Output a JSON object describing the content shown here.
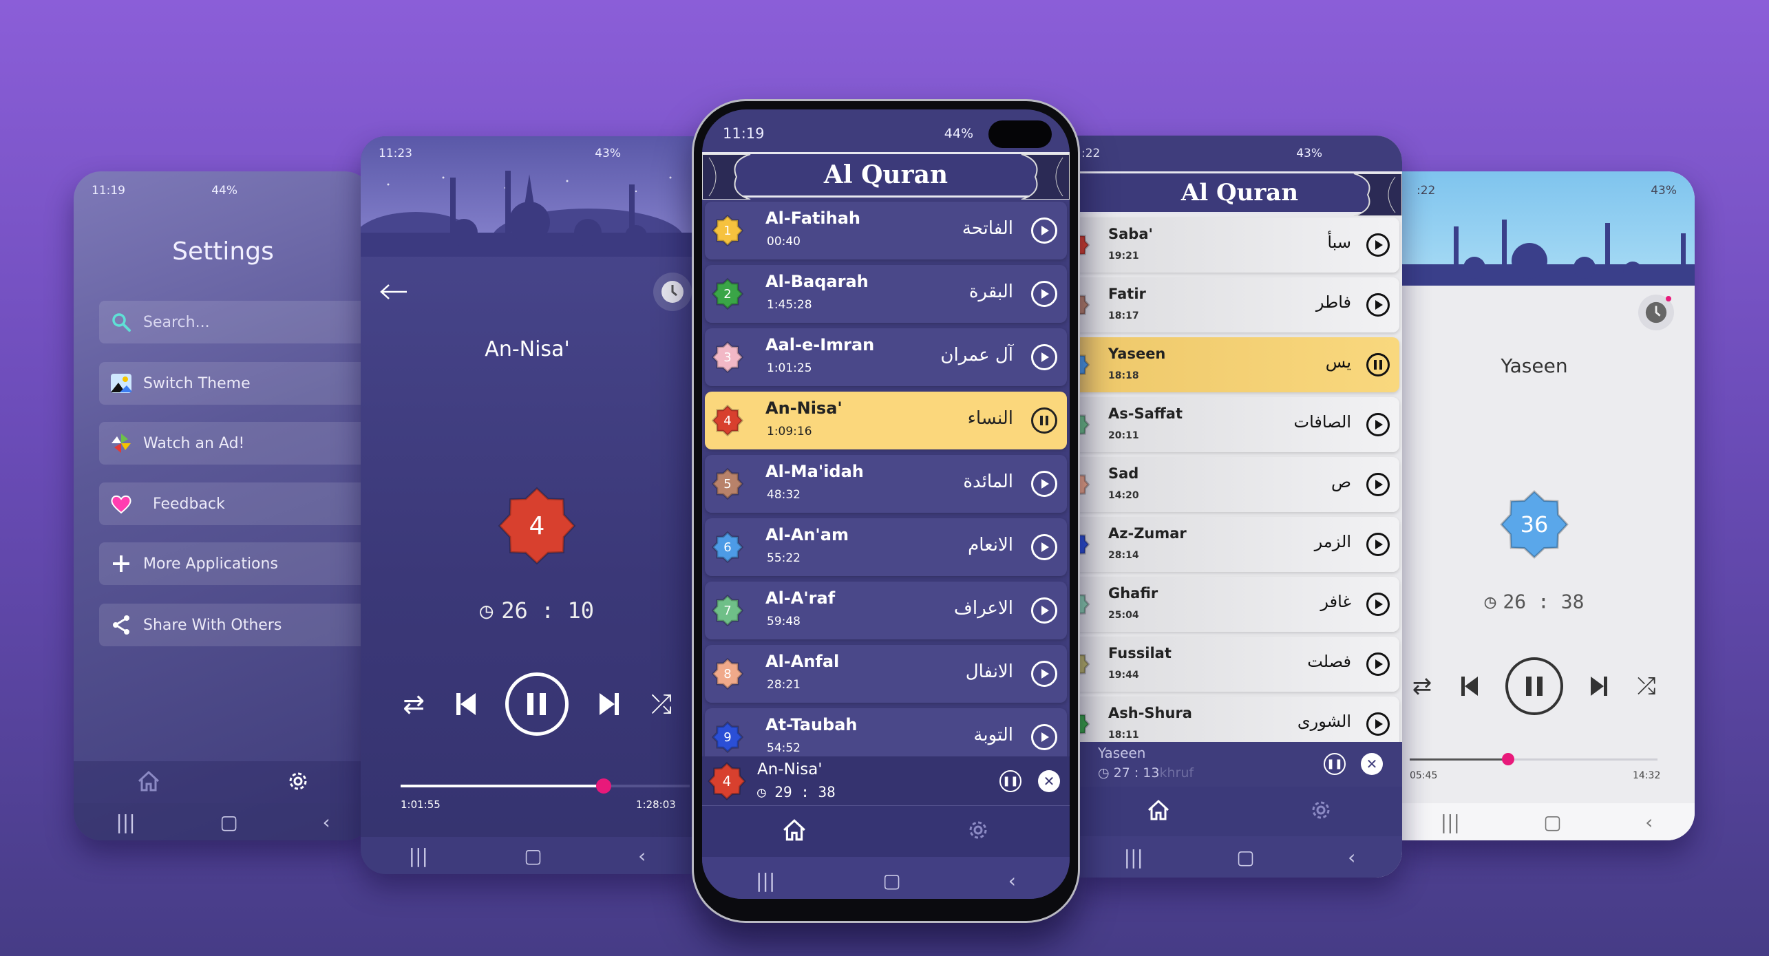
{
  "colors": {
    "accent": "#e8197a",
    "highlight": "#fbd77c",
    "primary": "#3f3d7c"
  },
  "settings_phone": {
    "status": {
      "time": "11:19",
      "battery": "44%"
    },
    "title": "Settings",
    "search_placeholder": "Search...",
    "items": [
      {
        "label": "Switch Theme",
        "icon": "image-icon"
      },
      {
        "label": "Watch an Ad!",
        "icon": "pinwheel-icon"
      },
      {
        "label": "Feedback",
        "icon": "heart-icon"
      },
      {
        "label": "More Applications",
        "icon": "plus-icon"
      },
      {
        "label": "Share With Others",
        "icon": "share-icon"
      }
    ]
  },
  "player_phone": {
    "status": {
      "time": "11:23",
      "battery": "43%"
    },
    "title": "An-Nisa'",
    "surah_number": "4",
    "timer": "26 : 10",
    "elapsed": "1:01:55",
    "total": "1:28:03",
    "progress": 0.703
  },
  "list_phone": {
    "status": {
      "time": "11:19",
      "battery": "44%"
    },
    "app_title": "Al Quran",
    "surahs": [
      {
        "number": "1",
        "name": "Al-Fatihah",
        "duration": "00:40",
        "arabic": "الفاتحة",
        "color": "#f6c23e",
        "state": "play"
      },
      {
        "number": "2",
        "name": "Al-Baqarah",
        "duration": "1:45:28",
        "arabic": "البقرة",
        "color": "#3aa547",
        "state": "play"
      },
      {
        "number": "3",
        "name": "Aal-e-Imran",
        "duration": "1:01:25",
        "arabic": "آل عمران",
        "color": "#f2b8c6",
        "state": "play"
      },
      {
        "number": "4",
        "name": "An-Nisa'",
        "duration": "1:09:16",
        "arabic": "النساء",
        "color": "#d8402e",
        "state": "pause"
      },
      {
        "number": "5",
        "name": "Al-Ma'idah",
        "duration": "48:32",
        "arabic": "المائدة",
        "color": "#b8826a",
        "state": "play"
      },
      {
        "number": "6",
        "name": "Al-An'am",
        "duration": "55:22",
        "arabic": "الانعام",
        "color": "#4d9be6",
        "state": "play"
      },
      {
        "number": "7",
        "name": "Al-A'raf",
        "duration": "59:48",
        "arabic": "الاعراف",
        "color": "#6fbf88",
        "state": "play"
      },
      {
        "number": "8",
        "name": "Al-Anfal",
        "duration": "28:21",
        "arabic": "الانفال",
        "color": "#f0a98a",
        "state": "play"
      },
      {
        "number": "9",
        "name": "At-Taubah",
        "duration": "54:52",
        "arabic": "التوبة",
        "color": "#2b4fd6",
        "state": "play"
      }
    ],
    "mini_player": {
      "number": "4",
      "title": "An-Nisa'",
      "timer": "29 : 38"
    }
  },
  "list_phone_light": {
    "status": {
      "time": ":22",
      "battery": "43%"
    },
    "app_title": "Al Quran",
    "surahs": [
      {
        "name": "Saba'",
        "duration": "19:21",
        "arabic": "سبأ",
        "color": "#d8402e",
        "state": "play"
      },
      {
        "name": "Fatir",
        "duration": "18:17",
        "arabic": "فاطر",
        "color": "#b8826a",
        "state": "play"
      },
      {
        "name": "Yaseen",
        "duration": "18:18",
        "arabic": "يس",
        "color": "#4d9be6",
        "state": "pause"
      },
      {
        "name": "As-Saffat",
        "duration": "20:11",
        "arabic": "الصافات",
        "color": "#6fbf88",
        "state": "play"
      },
      {
        "name": "Sad",
        "duration": "14:20",
        "arabic": "ص",
        "color": "#f0a98a",
        "state": "play"
      },
      {
        "name": "Az-Zumar",
        "duration": "28:14",
        "arabic": "الزمر",
        "color": "#2b4fd6",
        "state": "play"
      },
      {
        "name": "Ghafir",
        "duration": "25:04",
        "arabic": "غافر",
        "color": "#8ccfb0",
        "state": "play"
      },
      {
        "name": "Fussilat",
        "duration": "19:44",
        "arabic": "فصلت",
        "color": "#b9b36a",
        "state": "play"
      },
      {
        "name": "Ash-Shura",
        "duration": "18:11",
        "arabic": "الشورى",
        "color": "#3aa547",
        "state": "play"
      }
    ],
    "mini_player": {
      "title": "Yaseen",
      "timer": "27 : 13",
      "behind_text": "khruf"
    }
  },
  "player_phone_light": {
    "status": {
      "time": ":22",
      "battery": "43%"
    },
    "title": "Yaseen",
    "surah_number": "36",
    "timer": "26 : 38",
    "elapsed": "05:45",
    "total": "14:32",
    "progress": 0.396
  }
}
